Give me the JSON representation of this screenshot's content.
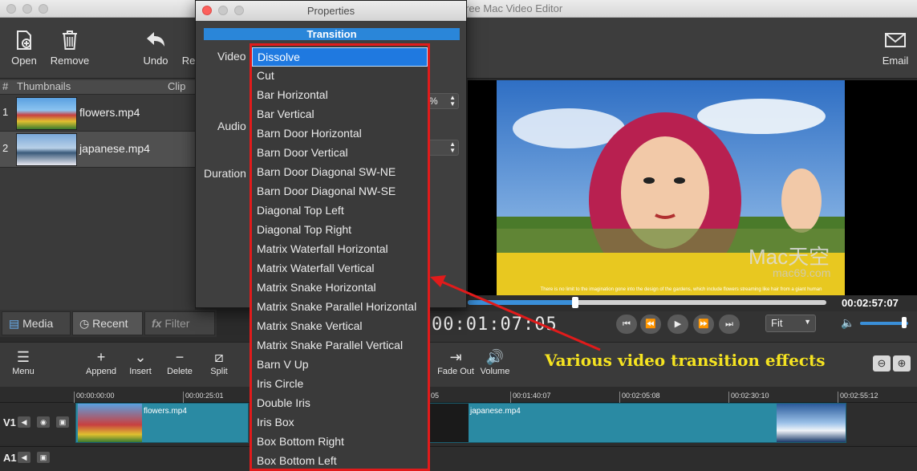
{
  "window": {
    "app_title": "ree Mac Video Editor"
  },
  "toolbar": {
    "open": "Open",
    "remove": "Remove",
    "undo": "Undo",
    "redo": "Re",
    "email": "Email"
  },
  "clip_list": {
    "header_num": "#",
    "header_thumbs": "Thumbnails",
    "header_clip": "Clip",
    "items": [
      {
        "num": "1",
        "name": "flowers.mp4"
      },
      {
        "num": "2",
        "name": "japanese.mp4"
      }
    ]
  },
  "media_tabs": {
    "media": "Media",
    "recent": "Recent",
    "filter": "Filter"
  },
  "properties": {
    "title": "Properties",
    "section": "Transition",
    "video_label": "Video",
    "audio_label": "Audio",
    "duration_label": "Duration",
    "percent_suffix": "%"
  },
  "transition_options": [
    "Dissolve",
    "Cut",
    "Bar Horizontal",
    "Bar Vertical",
    "Barn Door Horizontal",
    "Barn Door Vertical",
    "Barn Door Diagonal SW-NE",
    "Barn Door Diagonal NW-SE",
    "Diagonal Top Left",
    "Diagonal Top Right",
    "Matrix Waterfall Horizontal",
    "Matrix Waterfall Vertical",
    "Matrix Snake Horizontal",
    "Matrix Snake Parallel Horizontal",
    "Matrix Snake Vertical",
    "Matrix Snake Parallel Vertical",
    "Barn V Up",
    "Iris Circle",
    "Double Iris",
    "Iris Box",
    "Box Bottom Right",
    "Box Bottom Left"
  ],
  "selected_option": "Dissolve",
  "preview": {
    "caption": "There is no limit to the imagination gone into the design of the gardens, which include flowers streaming like hair from a giant human",
    "watermark": "Mac天空",
    "watermark_url": "mac69.com",
    "duration": "00:02:57:07",
    "timecode": "00:01:07:05",
    "fit": "Fit",
    "progress": 0.3,
    "volume": 0.9
  },
  "timeline_toolbar": {
    "menu": "Menu",
    "append": "Append",
    "insert": "Insert",
    "delete": "Delete",
    "split": "Split",
    "fade_out": "Fade Out",
    "volume": "Volume"
  },
  "annotation": "Various video transition effects",
  "ruler": [
    "00:00:00:00",
    "00:00:25:01",
    "05",
    "00:01:40:07",
    "00:02:05:08",
    "00:02:30:10",
    "00:02:55:12"
  ],
  "tracks": {
    "v1": "V1",
    "a1": "A1",
    "clip1": "flowers.mp4",
    "clip2": "japanese.mp4"
  },
  "colors": {
    "accent": "#2a86d9",
    "highlight_border": "#e11b1b",
    "annotation": "#f5e321",
    "clip": "#2a8aa3"
  }
}
